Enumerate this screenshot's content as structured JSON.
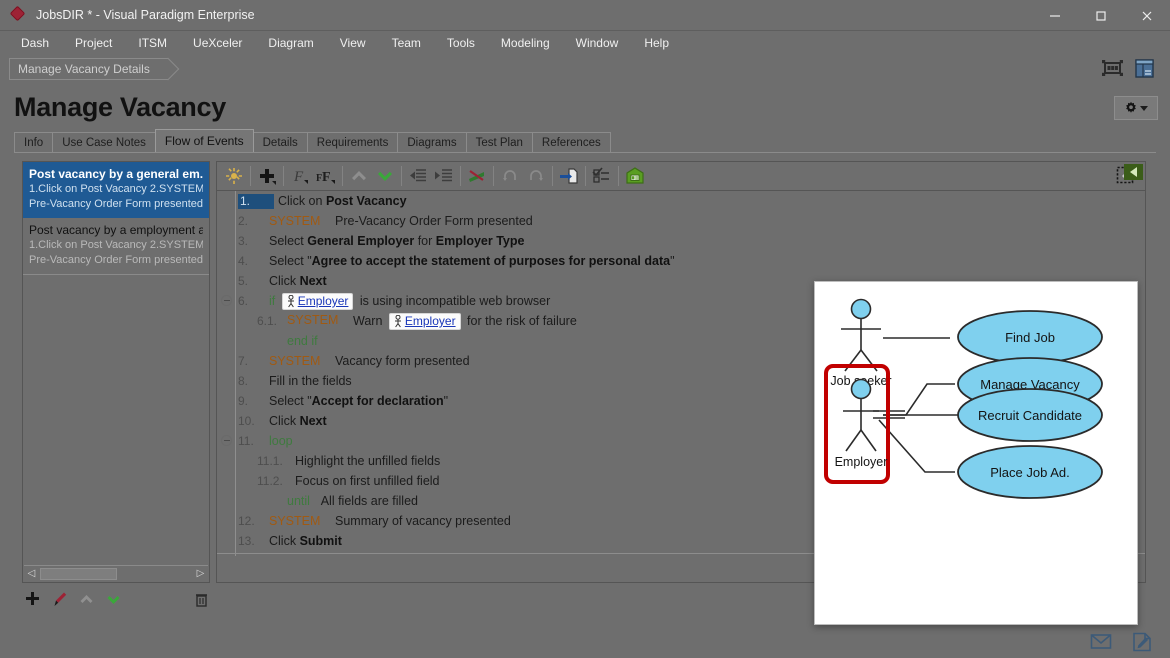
{
  "window": {
    "title": "JobsDIR * - Visual Paradigm Enterprise",
    "logo_icon": "diamond-logo-icon",
    "minimize_icon": "minimize-icon",
    "maximize_icon": "maximize-icon",
    "close_icon": "close-icon"
  },
  "menu": {
    "items": [
      {
        "label": "Dash"
      },
      {
        "label": "Project"
      },
      {
        "label": "ITSM"
      },
      {
        "label": "UeXceler"
      },
      {
        "label": "Diagram"
      },
      {
        "label": "View"
      },
      {
        "label": "Team"
      },
      {
        "label": "Tools"
      },
      {
        "label": "Modeling"
      },
      {
        "label": "Window"
      },
      {
        "label": "Help"
      }
    ]
  },
  "breadcrumb": {
    "label": "Manage Vacancy Details"
  },
  "header": {
    "title": "Manage Vacancy",
    "gear_label": "",
    "top_right_icons": [
      {
        "name": "filmstrip-icon"
      },
      {
        "name": "panel-layout-icon"
      }
    ]
  },
  "tabs": {
    "items": [
      {
        "label": "Info",
        "active": false
      },
      {
        "label": "Use Case Notes",
        "active": false
      },
      {
        "label": "Flow of Events",
        "active": true
      },
      {
        "label": "Details",
        "active": false
      },
      {
        "label": "Requirements",
        "active": false
      },
      {
        "label": "Diagrams",
        "active": false
      },
      {
        "label": "Test Plan",
        "active": false
      },
      {
        "label": "References",
        "active": false
      }
    ]
  },
  "scenarios": {
    "items": [
      {
        "title": "Post vacancy by a general em.",
        "subtitle_1": "1.Click on Post Vacancy 2.SYSTEM",
        "subtitle_2": "Pre-Vacancy Order Form presented...",
        "selected": true
      },
      {
        "title": "Post vacancy by a employment ager",
        "subtitle_1": "1.Click on Post Vacancy 2.SYSTEM",
        "subtitle_2": "Pre-Vacancy Order Form presented...",
        "selected": false
      }
    ],
    "bottom_tools": [
      {
        "name": "add-scenario-icon"
      },
      {
        "name": "edit-pen-icon"
      },
      {
        "name": "move-up-icon"
      },
      {
        "name": "move-down-icon"
      },
      {
        "name": "delete-trash-icon"
      }
    ],
    "scroll_left_icon": "scroll-left-icon",
    "scroll_right_icon": "scroll-right-icon"
  },
  "flow_toolbar": {
    "buttons": [
      {
        "name": "sparkle-icon"
      },
      {
        "name": "add-step-icon"
      },
      {
        "name": "format-italic-icon"
      },
      {
        "name": "format-font-icon"
      },
      {
        "name": "move-up-icon"
      },
      {
        "name": "move-down-icon"
      },
      {
        "name": "outdent-icon"
      },
      {
        "name": "indent-icon"
      },
      {
        "name": "flag-icon"
      },
      {
        "name": "undo-icon"
      },
      {
        "name": "redo-icon"
      },
      {
        "name": "insert-doc-icon"
      },
      {
        "name": "checklist-icon"
      },
      {
        "name": "wireframe-icon"
      }
    ],
    "right_button": {
      "name": "marquee-select-icon"
    },
    "collapse_tab": {
      "name": "collapse-left-icon"
    }
  },
  "flow_of_events": {
    "rows": [
      {
        "num": "1.",
        "selected": true,
        "fold": false,
        "indent": 0,
        "parts": [
          {
            "t": "Click on ",
            "s": "n"
          },
          {
            "t": "Post Vacancy",
            "s": "b"
          }
        ]
      },
      {
        "num": "2.",
        "selected": false,
        "fold": false,
        "indent": 0,
        "parts": [
          {
            "t": "SYSTEM",
            "s": "sys"
          },
          {
            "t": "Pre-Vacancy Order Form presented",
            "s": "n"
          }
        ]
      },
      {
        "num": "3.",
        "selected": false,
        "fold": false,
        "indent": 0,
        "parts": [
          {
            "t": "Select ",
            "s": "n"
          },
          {
            "t": "General Employer",
            "s": "b"
          },
          {
            "t": " for ",
            "s": "n"
          },
          {
            "t": "Employer Type",
            "s": "b"
          }
        ]
      },
      {
        "num": "4.",
        "selected": false,
        "fold": false,
        "indent": 0,
        "parts": [
          {
            "t": "Select \"",
            "s": "n"
          },
          {
            "t": "Agree to accept the statement of purposes for personal data",
            "s": "b"
          },
          {
            "t": "\"",
            "s": "n"
          }
        ]
      },
      {
        "num": "5.",
        "selected": false,
        "fold": false,
        "indent": 0,
        "parts": [
          {
            "t": "Click ",
            "s": "n"
          },
          {
            "t": "Next",
            "s": "b"
          }
        ]
      },
      {
        "num": "6.",
        "selected": false,
        "fold": true,
        "indent": 0,
        "parts": [
          {
            "t": "if",
            "s": "kw"
          },
          {
            "t": "Employer",
            "s": "chip"
          },
          {
            "t": "is using incompatible web browser",
            "s": "n"
          }
        ]
      },
      {
        "num": "6.1.",
        "selected": false,
        "fold": false,
        "indent": 1,
        "parts": [
          {
            "t": "SYSTEM",
            "s": "sys"
          },
          {
            "t": "Warn ",
            "s": "n"
          },
          {
            "t": "Employer",
            "s": "chip"
          },
          {
            "t": "for the risk of failure",
            "s": "n"
          }
        ]
      },
      {
        "num": "",
        "selected": false,
        "fold": false,
        "indent": 1,
        "parts": [
          {
            "t": "end if",
            "s": "kw"
          }
        ]
      },
      {
        "num": "7.",
        "selected": false,
        "fold": false,
        "indent": 0,
        "parts": [
          {
            "t": "SYSTEM",
            "s": "sys"
          },
          {
            "t": "Vacancy form presented",
            "s": "n"
          }
        ]
      },
      {
        "num": "8.",
        "selected": false,
        "fold": false,
        "indent": 0,
        "parts": [
          {
            "t": "Fill in the fields",
            "s": "n"
          }
        ]
      },
      {
        "num": "9.",
        "selected": false,
        "fold": false,
        "indent": 0,
        "parts": [
          {
            "t": "Select \"",
            "s": "n"
          },
          {
            "t": "Accept for declaration",
            "s": "b"
          },
          {
            "t": "\"",
            "s": "n"
          }
        ]
      },
      {
        "num": "10.",
        "selected": false,
        "fold": false,
        "indent": 0,
        "parts": [
          {
            "t": "Click ",
            "s": "n"
          },
          {
            "t": "Next",
            "s": "b"
          }
        ]
      },
      {
        "num": "11.",
        "selected": false,
        "fold": true,
        "indent": 0,
        "parts": [
          {
            "t": "loop",
            "s": "kw"
          }
        ]
      },
      {
        "num": "11.1.",
        "selected": false,
        "fold": false,
        "indent": 1,
        "parts": [
          {
            "t": "Highlight the unfilled fields",
            "s": "n"
          }
        ]
      },
      {
        "num": "11.2.",
        "selected": false,
        "fold": false,
        "indent": 1,
        "parts": [
          {
            "t": "Focus on first unfilled field",
            "s": "n"
          }
        ]
      },
      {
        "num": "",
        "selected": false,
        "fold": false,
        "indent": 1,
        "parts": [
          {
            "t": "until",
            "s": "kw"
          },
          {
            "t": "  All fields are filled",
            "s": "n"
          }
        ]
      },
      {
        "num": "12.",
        "selected": false,
        "fold": false,
        "indent": 0,
        "parts": [
          {
            "t": "SYSTEM",
            "s": "sys"
          },
          {
            "t": "Summary of vacancy presented",
            "s": "n"
          }
        ]
      },
      {
        "num": "13.",
        "selected": false,
        "fold": false,
        "indent": 0,
        "parts": [
          {
            "t": "Click ",
            "s": "n"
          },
          {
            "t": "Submit",
            "s": "b"
          }
        ]
      }
    ]
  },
  "use_case_diagram": {
    "colors": {
      "ellipse_fill": "#7fd0ee",
      "ellipse_stroke": "#333333",
      "actor_head_fill": "#7fd0ee",
      "highlight_stroke": "#c10000",
      "background": "#ffffff"
    },
    "actors": [
      {
        "name": "Job seeker",
        "highlighted": false
      },
      {
        "name": "Employer",
        "highlighted": true
      }
    ],
    "use_cases": [
      {
        "name": "Find Job"
      },
      {
        "name": "Manage Vacancy"
      },
      {
        "name": "Recruit Candidate"
      },
      {
        "name": "Place Job Ad."
      }
    ],
    "associations": [
      {
        "from": "Job seeker",
        "to": "Find Job"
      },
      {
        "from": "Employer",
        "to": "Manage Vacancy"
      },
      {
        "from": "Employer",
        "to": "Recruit Candidate"
      },
      {
        "from": "Employer",
        "to": "Place Job Ad."
      }
    ]
  },
  "status_bar": {
    "icons": [
      {
        "name": "mail-envelope-icon"
      },
      {
        "name": "note-edit-icon"
      }
    ]
  }
}
